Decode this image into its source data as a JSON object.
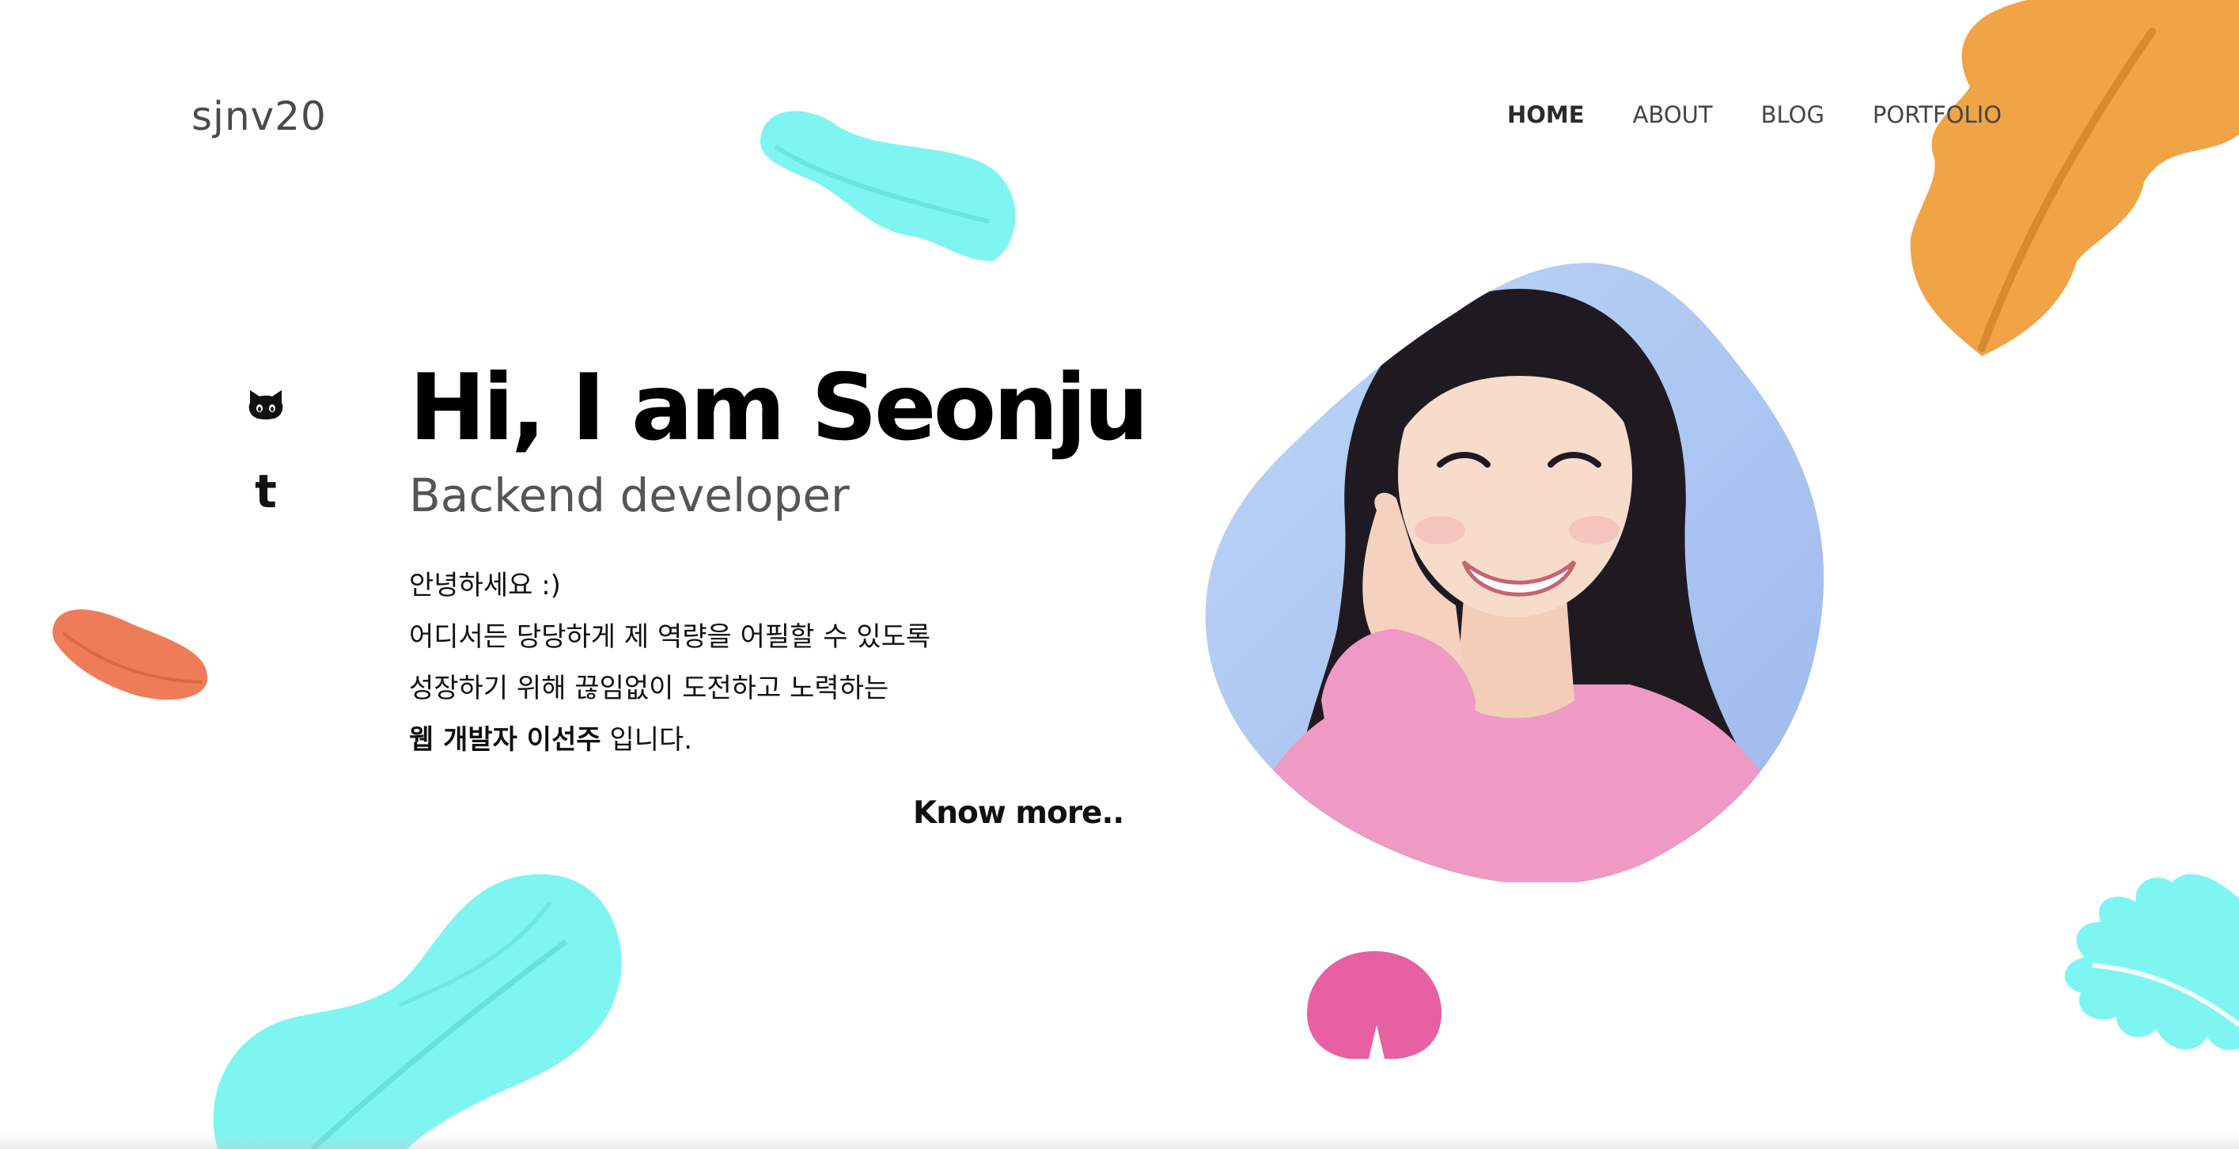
{
  "header": {
    "logo": "sjnv20",
    "nav": [
      {
        "label": "HOME",
        "active": true
      },
      {
        "label": "ABOUT",
        "active": false
      },
      {
        "label": "BLOG",
        "active": false
      },
      {
        "label": "PORTFOLIO",
        "active": false
      }
    ]
  },
  "social": [
    {
      "icon": "github-icon"
    },
    {
      "icon": "tumblr-icon"
    }
  ],
  "hero": {
    "title": "Hi, I am Seonju",
    "subtitle": "Backend developer",
    "intro": {
      "line1": "안녕하세요 :)",
      "line2": "어디서든 당당하게 제 역량을 어필할 수 있도록",
      "line3": "성장하기 위해 끊임없이 도전하고 노력하는",
      "line4_bold": "웹 개발자 이선주",
      "line4_rest": " 입니다."
    },
    "cta": "Know more.."
  },
  "colors": {
    "teal_leaf": "#7EF5F0",
    "orange_leaf": "#F0A445",
    "coral_leaf": "#EF7C58",
    "pink_leaf": "#E660A2",
    "portrait_bg": "#AFC9F2",
    "sweater": "#EE9AC4"
  }
}
